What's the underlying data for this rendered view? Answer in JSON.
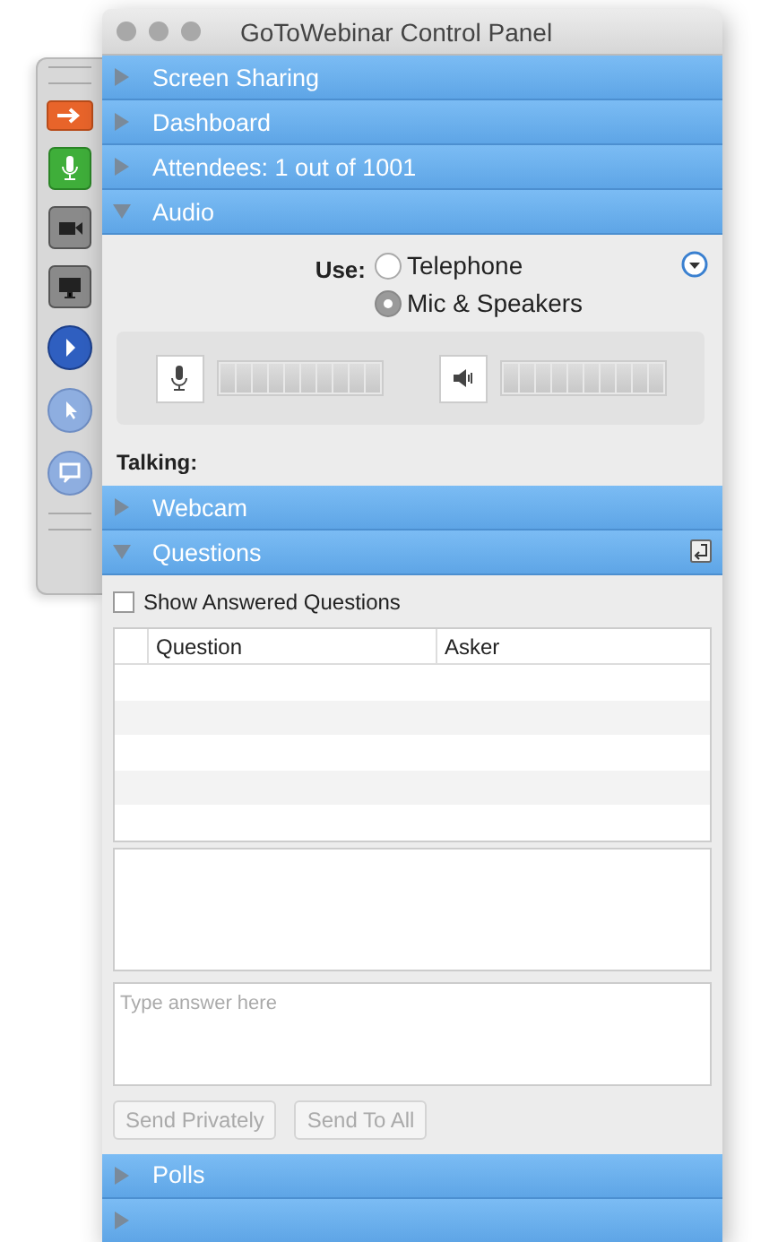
{
  "window": {
    "title": "GoToWebinar Control Panel"
  },
  "sections": [
    {
      "kind": "plain",
      "title": "Screen Sharing",
      "expanded": false
    },
    {
      "kind": "plain",
      "title": "Dashboard",
      "expanded": false
    },
    {
      "kind": "plain",
      "title": "Attendees: 1 out of 1001",
      "expanded": false
    },
    {
      "kind": "audio",
      "title": "Audio",
      "expanded": true,
      "use_label": "Use:",
      "options": [
        {
          "label": "Telephone",
          "selected": false
        },
        {
          "label": "Mic & Speakers",
          "selected": true
        }
      ],
      "meters": [
        {
          "kind": "mic",
          "level": 0
        },
        {
          "kind": "speaker",
          "level": 0
        }
      ],
      "talking_label": "Talking:"
    },
    {
      "kind": "plain",
      "title": "Webcam",
      "expanded": false
    },
    {
      "kind": "questions",
      "title": "Questions",
      "expanded": true,
      "show_answered": {
        "label": "Show Answered Questions",
        "checked": false
      },
      "columns": [
        "Question",
        "Asker"
      ],
      "answer_placeholder": "Type answer here",
      "buttons": [
        {
          "label": "Send Privately",
          "disabled": true
        },
        {
          "label": "Send To All",
          "disabled": true
        }
      ]
    },
    {
      "kind": "plain",
      "title": "Polls",
      "expanded": false
    },
    {
      "kind": "plain",
      "expanded": false
    }
  ]
}
